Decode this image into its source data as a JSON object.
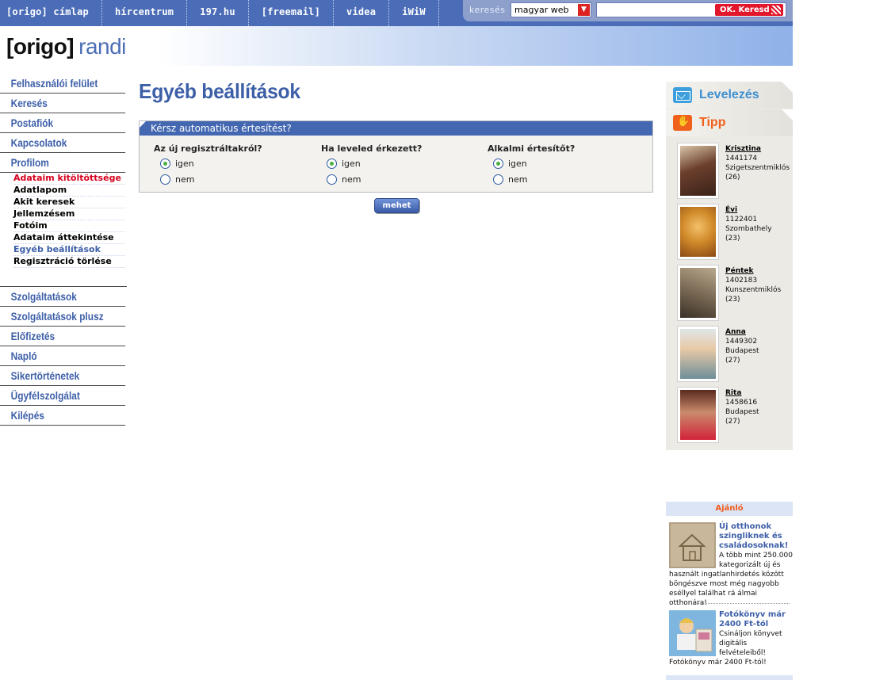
{
  "topnav": [
    {
      "label": "[origo] címlap"
    },
    {
      "label": "hírcentrum"
    },
    {
      "label": "197.hu"
    },
    {
      "label": "[freemail]"
    },
    {
      "label": "videa"
    },
    {
      "label": "iWiW"
    }
  ],
  "search": {
    "label": "keresés",
    "scope": "magyar web",
    "input_value": "",
    "button_label": "OK. Keresd"
  },
  "header": {
    "brand": "[origo]",
    "section": "randi"
  },
  "leftmenu": {
    "items": [
      {
        "label": "Felhasználói felület"
      },
      {
        "label": "Keresés"
      },
      {
        "label": "Postafiók"
      },
      {
        "label": "Kapcsolatok"
      },
      {
        "label": "Profilom"
      }
    ],
    "submenu": [
      {
        "label": "Adataim kitöltöttsége"
      },
      {
        "label": "Adatlapom"
      },
      {
        "label": "Akit keresek"
      },
      {
        "label": "Jellemzésem"
      },
      {
        "label": "Fotóim"
      },
      {
        "label": "Adataim áttekintése"
      },
      {
        "label": "Egyéb beállítások"
      },
      {
        "label": "Regisztráció törlése"
      }
    ],
    "items2": [
      {
        "label": "Szolgáltatások"
      },
      {
        "label": "Szolgáltatások plusz"
      },
      {
        "label": "Előfizetés"
      },
      {
        "label": "Napló"
      },
      {
        "label": "Sikertörténetek"
      },
      {
        "label": "Ügyfélszolgálat"
      },
      {
        "label": "Kilépés"
      }
    ]
  },
  "main": {
    "title": "Egyéb beállítások",
    "box_header": "Kérsz automatikus értesítést?",
    "questions": [
      {
        "label": "Az új regisztráltakról?",
        "yes": "igen",
        "no": "nem",
        "selected": "igen"
      },
      {
        "label": "Ha leveled érkezett?",
        "yes": "igen",
        "no": "nem",
        "selected": "igen"
      },
      {
        "label": "Alkalmi értesítőt?",
        "yes": "igen",
        "no": "nem",
        "selected": "igen"
      }
    ],
    "submit_label": "mehet"
  },
  "rightbar": {
    "tabs": [
      {
        "label": "Levelezés",
        "icon": "mail-icon"
      },
      {
        "label": "Tipp",
        "icon": "thumbs-up-icon"
      }
    ],
    "profiles": [
      {
        "name": "Krisztina",
        "id": "1441174",
        "city": "Szigetszentmiklós",
        "age": "(26)",
        "photo_color": "#6b3f2c"
      },
      {
        "name": "Évi",
        "id": "1122401",
        "city": "Szombathely",
        "age": "(23)",
        "photo_color": "#d08a2a"
      },
      {
        "name": "Péntek",
        "id": "1402183",
        "city": "Kunszentmiklós",
        "age": "(23)",
        "photo_color": "#7a6a55"
      },
      {
        "name": "Anna",
        "id": "1449302",
        "city": "Budapest",
        "age": "(27)",
        "photo_color": "#9fb4bd"
      },
      {
        "name": "Rita",
        "id": "1458616",
        "city": "Budapest",
        "age": "(27)",
        "photo_color": "#5a2a1f"
      }
    ]
  },
  "ajanlo": {
    "header": "Ajánló",
    "ads": [
      {
        "title": "Új otthonok szingliknek és családosoknak!",
        "text": "A több mint 250.000 kategorizált új és használt ingatlanhirdetés között böngészve most még nagyobb eséllyel találhat rá álmai otthonára!",
        "icon": "house-sand-drawing-icon"
      },
      {
        "title": "Fotókönyv már 2400 Ft-tól",
        "text": "Csináljon könyvet digitális felvételeiből! Fotókönyv már 2400 Ft-tól!",
        "icon": "photobook-icon"
      }
    ]
  },
  "colors": {
    "brand_blue": "#4b6cb7",
    "heading_blue": "#3d5fa8",
    "accent_red": "#d6001c",
    "tipp_orange": "#f0621b",
    "radio_green": "#4bb041"
  }
}
